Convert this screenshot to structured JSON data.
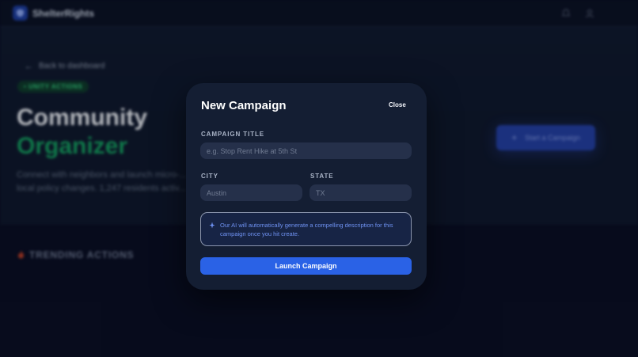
{
  "app": {
    "brand": "ShelterRights"
  },
  "hero": {
    "back_label": "Back to dashboard",
    "badge": "UNITY ACTIONS",
    "title_line1": "Community",
    "title_line2": "Organizer",
    "description": "Connect with neighbors and launch micro-... local policy changes. 1,247 residents activ...",
    "start_button": "Start a Campaign"
  },
  "trending": {
    "label": "TRENDING ACTIONS"
  },
  "modal": {
    "title": "New Campaign",
    "close_label": "Close",
    "campaign_title_label": "CAMPAIGN TITLE",
    "campaign_title_placeholder": "e.g. Stop Rent Hike at 5th St",
    "campaign_title_value": "",
    "city_label": "CITY",
    "city_placeholder": "Austin",
    "city_value": "",
    "state_label": "STATE",
    "state_placeholder": "TX",
    "state_value": "",
    "ai_notice": "Our AI will automatically generate a compelling description for this campaign once you hit create.",
    "launch_label": "Launch Campaign"
  },
  "icons": {
    "logo": "shield-icon",
    "top_right": [
      "bell-icon",
      "user-icon"
    ],
    "back": "arrow-left-icon",
    "badge": "dot-icon",
    "start": "plus-icon",
    "trending": "flame-icon",
    "ai": "sparkle-icon"
  },
  "colors": {
    "background": "#0a0f25",
    "modal": "#141e33",
    "accent": "#2a62e6",
    "ai_text": "#6f92f2",
    "organizer_green": "#14995e"
  }
}
